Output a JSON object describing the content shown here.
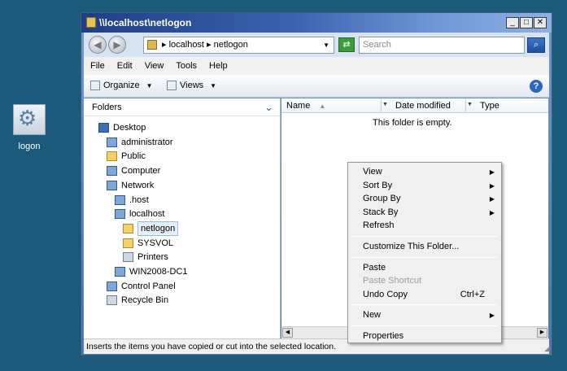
{
  "desktop": {
    "icon_label": "logon"
  },
  "window": {
    "title": "\\\\localhost\\netlogon",
    "address": [
      "localhost",
      "netlogon"
    ],
    "search_placeholder": "Search",
    "menu": [
      "File",
      "Edit",
      "View",
      "Tools",
      "Help"
    ],
    "toolbar": {
      "organize": "Organize",
      "views": "Views"
    },
    "folders_header": "Folders",
    "tree": [
      {
        "label": "Desktop",
        "icon": "desktop-icon",
        "level": 0,
        "selected": false
      },
      {
        "label": "administrator",
        "icon": "user-folder-icon",
        "level": 1,
        "selected": false
      },
      {
        "label": "Public",
        "icon": "folder-icon",
        "level": 1,
        "selected": false
      },
      {
        "label": "Computer",
        "icon": "computer-icon",
        "level": 1,
        "selected": false
      },
      {
        "label": "Network",
        "icon": "network-icon",
        "level": 1,
        "selected": false
      },
      {
        "label": ".host",
        "icon": "computer-icon",
        "level": 2,
        "selected": false
      },
      {
        "label": "localhost",
        "icon": "computer-icon",
        "level": 2,
        "selected": false
      },
      {
        "label": "netlogon",
        "icon": "share-folder-icon",
        "level": 3,
        "selected": true
      },
      {
        "label": "SYSVOL",
        "icon": "share-folder-icon",
        "level": 3,
        "selected": false
      },
      {
        "label": "Printers",
        "icon": "printer-folder-icon",
        "level": 3,
        "selected": false
      },
      {
        "label": "WIN2008-DC1",
        "icon": "computer-icon",
        "level": 2,
        "selected": false
      },
      {
        "label": "Control Panel",
        "icon": "control-panel-icon",
        "level": 1,
        "selected": false
      },
      {
        "label": "Recycle Bin",
        "icon": "recycle-bin-icon",
        "level": 1,
        "selected": false
      }
    ],
    "columns": [
      "Name",
      "Date modified",
      "Type"
    ],
    "empty_text": "This folder is empty.",
    "status_text": "Inserts the items you have copied or cut into the selected location."
  },
  "context_menu": [
    {
      "label": "View",
      "submenu": true
    },
    {
      "label": "Sort By",
      "submenu": true
    },
    {
      "label": "Group By",
      "submenu": true
    },
    {
      "label": "Stack By",
      "submenu": true
    },
    {
      "label": "Refresh"
    },
    {
      "separator": true
    },
    {
      "label": "Customize This Folder..."
    },
    {
      "separator": true
    },
    {
      "label": "Paste"
    },
    {
      "label": "Paste Shortcut",
      "disabled": true
    },
    {
      "label": "Undo Copy",
      "shortcut": "Ctrl+Z"
    },
    {
      "separator": true
    },
    {
      "label": "New",
      "submenu": true
    },
    {
      "separator": true
    },
    {
      "label": "Properties"
    }
  ]
}
